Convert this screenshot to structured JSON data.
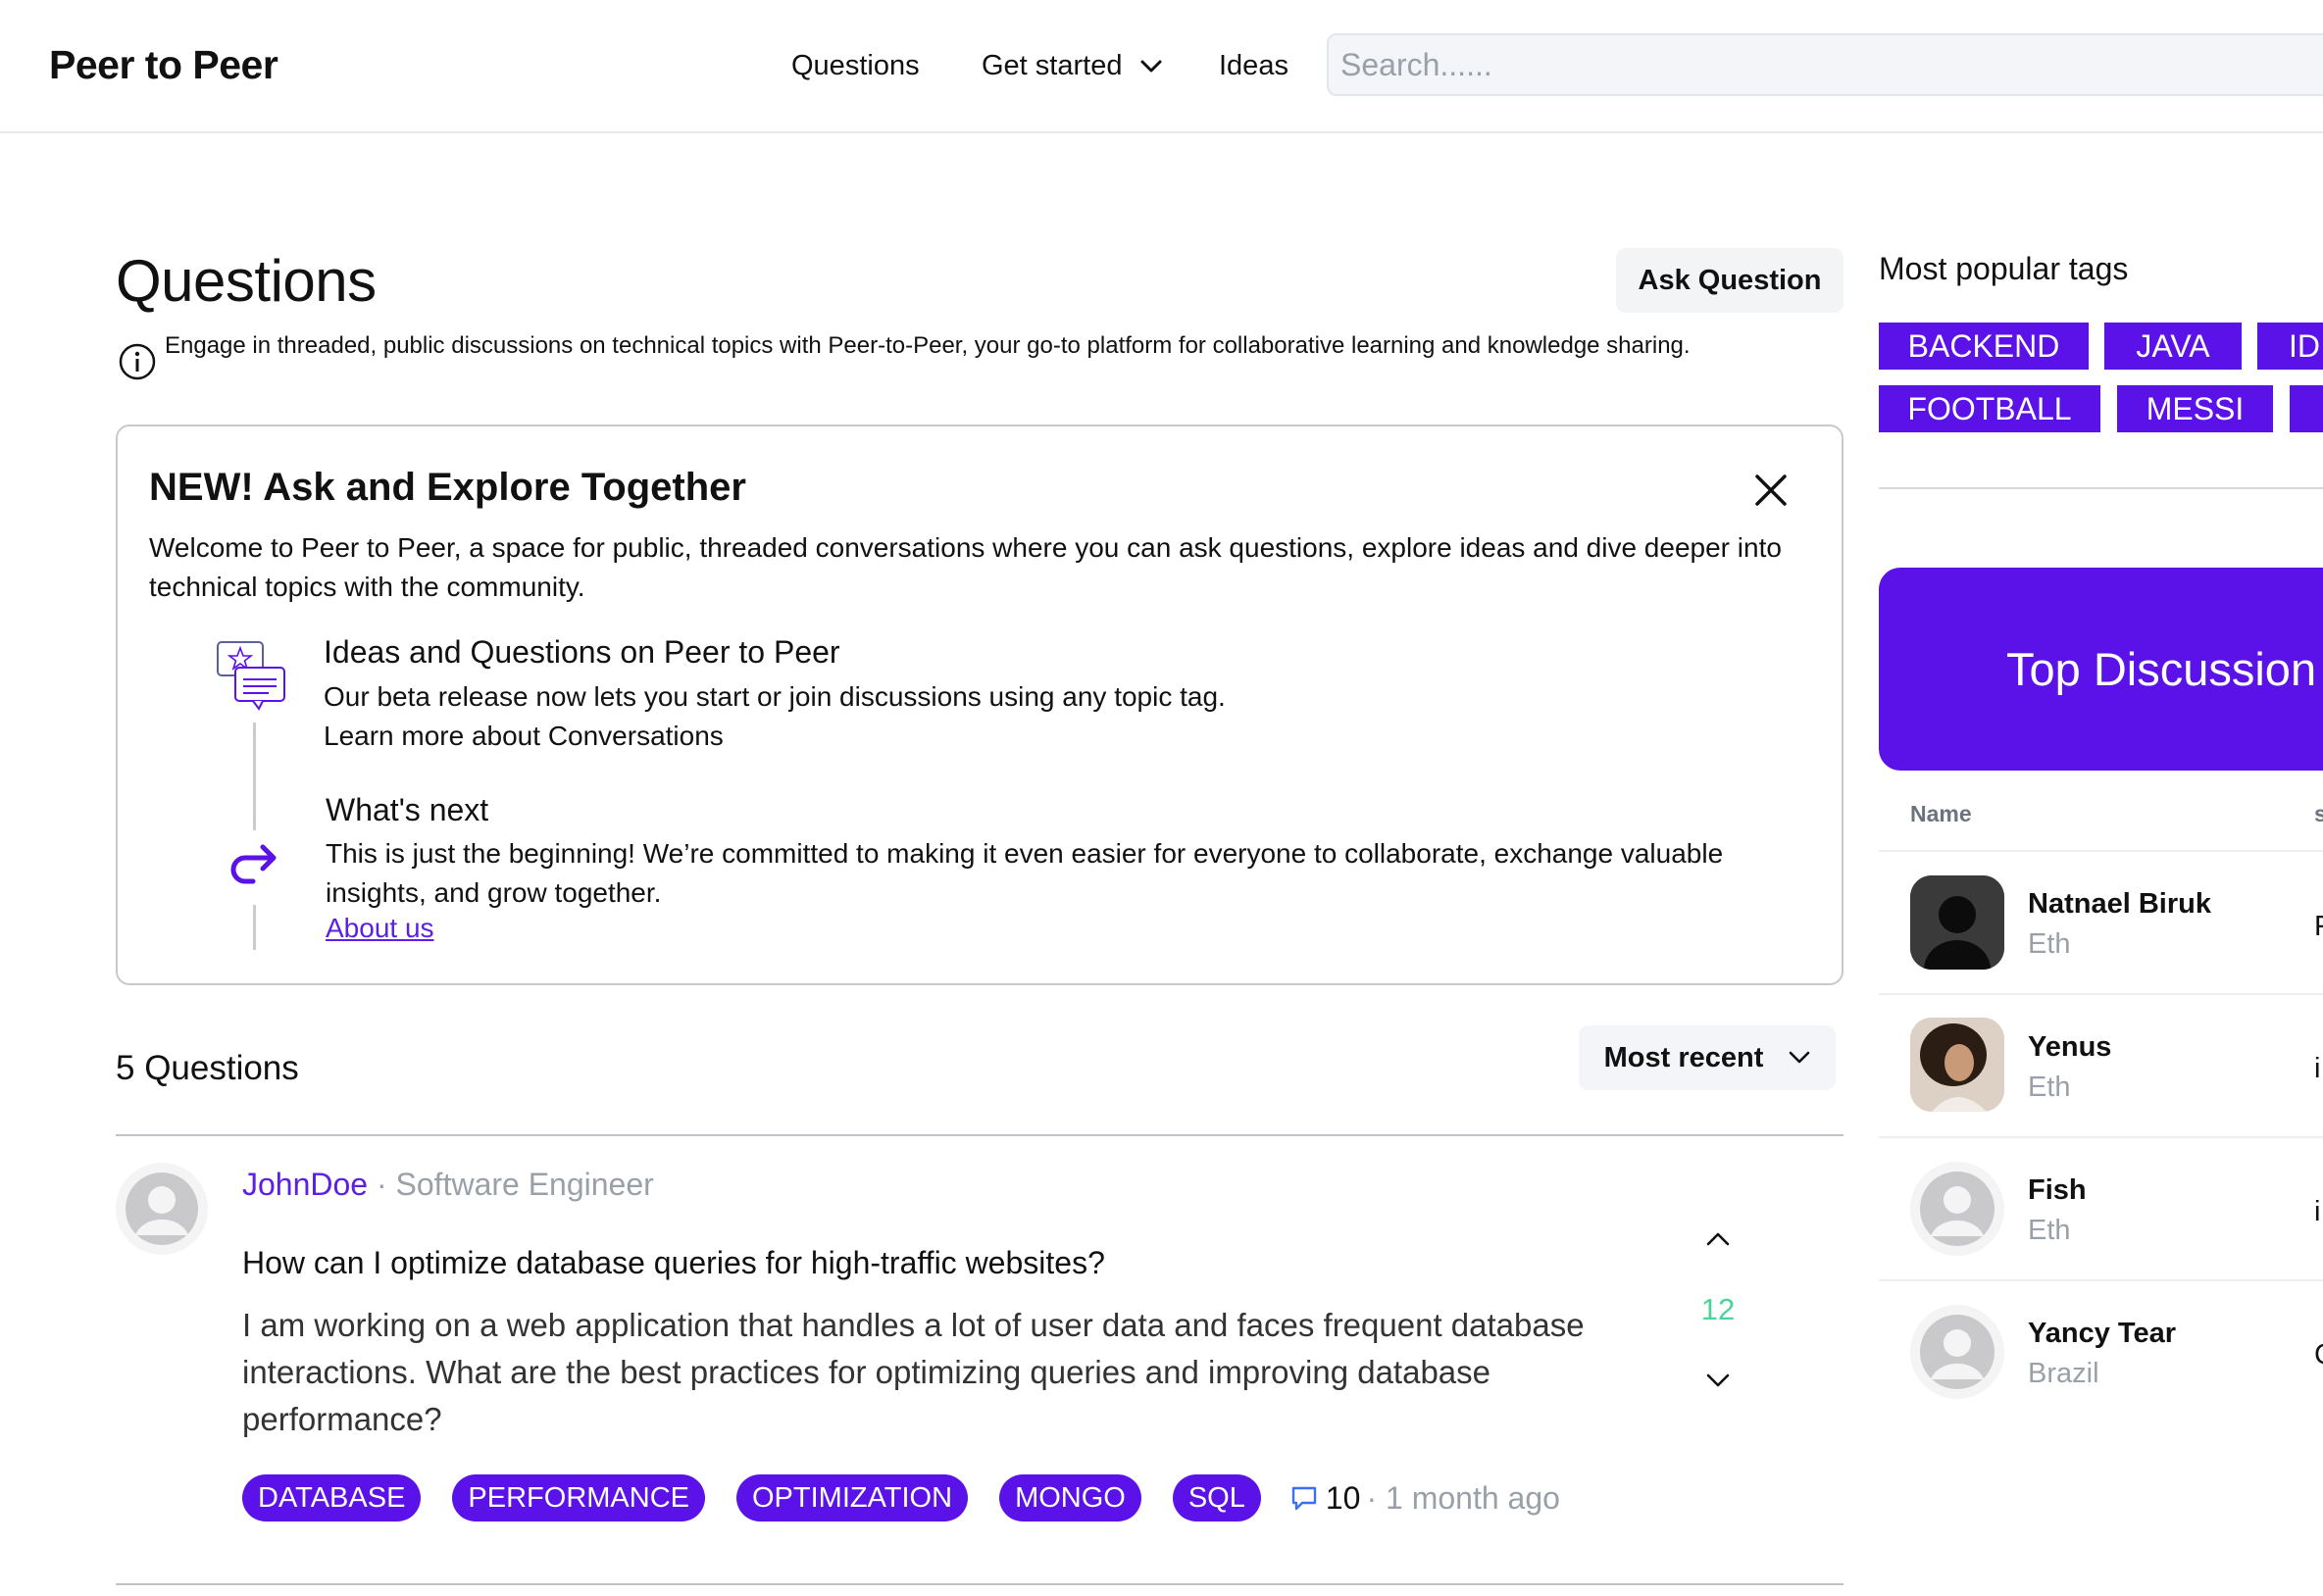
{
  "header": {
    "brand": "Peer to Peer",
    "nav": {
      "questions": "Questions",
      "get_started": "Get started",
      "ideas": "Ideas"
    },
    "search_placeholder": "Search......"
  },
  "main": {
    "title": "Questions",
    "ask_button": "Ask Question",
    "info_text": "Engage in threaded, public discussions on technical topics with Peer-to-Peer, your go-to platform for collaborative learning and knowledge sharing.",
    "banner": {
      "title": "NEW! Ask and Explore Together",
      "description": "Welcome to Peer to Peer, a space for public, threaded conversations where you can ask questions, explore ideas and dive deeper into technical topics with the community.",
      "items": [
        {
          "title": "Ideas and Questions on Peer to Peer",
          "line1": "Our beta release now lets you start or join discussions using any topic tag.",
          "line2": "Learn more about Conversations"
        },
        {
          "title": "What's next",
          "text": "This is just the beginning! We’re committed to making it even easier for everyone to collaborate, exchange valuable insights, and grow together.",
          "link": "About us"
        }
      ]
    },
    "question_count": "5 Questions",
    "sort_label": "Most recent",
    "questions": [
      {
        "author": "JohnDoe",
        "separator": " · ",
        "role": "Software Engineer",
        "title": "How can I optimize database queries for high-traffic websites?",
        "body": "I am working on a web application that handles a lot of user data and faces frequent database interactions. What are the best practices for optimizing queries and improving database performance?",
        "votes": "12",
        "tags": [
          "DATABASE",
          "PERFORMANCE",
          "OPTIMIZATION",
          "MONGO",
          "SQL"
        ],
        "comments": "10",
        "time": "· 1 month ago"
      }
    ]
  },
  "sidebar": {
    "popular_tags_title": "Most popular tags",
    "tags_row1": [
      "BACKEND",
      "JAVA",
      "ID"
    ],
    "tags_row2": [
      "FOOTBALL",
      "MESSI",
      ""
    ],
    "top_discussion_title": "Top Discussion",
    "columns": {
      "name": "Name",
      "second": "s"
    },
    "users": [
      {
        "name": "Natnael Biruk",
        "location": "Eth",
        "extra": "F"
      },
      {
        "name": "Yenus",
        "location": "Eth",
        "extra": "i"
      },
      {
        "name": "Fish",
        "location": "Eth",
        "extra": "i"
      },
      {
        "name": "Yancy Tear",
        "location": "Brazil",
        "extra": "C"
      }
    ]
  },
  "colors": {
    "accent": "#5b12e8",
    "vote_green": "#4cd39b",
    "muted": "#9aa0a8"
  }
}
